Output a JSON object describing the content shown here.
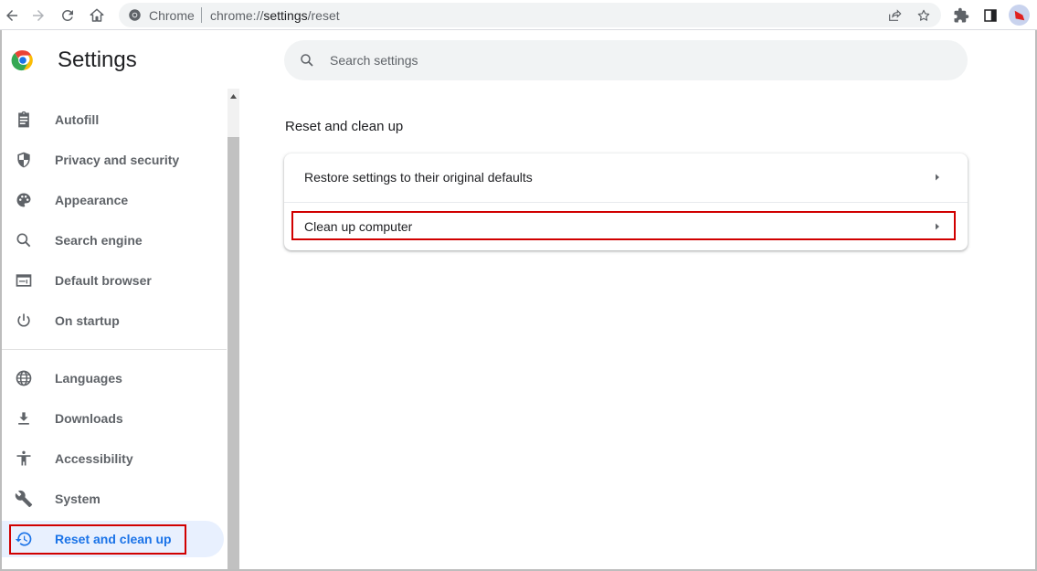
{
  "browser": {
    "site_chip": "Chrome",
    "url_prefix": "chrome://",
    "url_host": "settings",
    "url_path": "/reset",
    "icons": [
      "back-icon",
      "forward-icon",
      "reload-icon",
      "home-icon",
      "share-icon",
      "bookmark-star-icon",
      "extensions-icon",
      "side-panel-icon",
      "profile-avatar"
    ]
  },
  "header": {
    "title": "Settings",
    "search_placeholder": "Search settings"
  },
  "sidebar": {
    "items": [
      {
        "label": "Autofill",
        "icon": "clipboard-icon"
      },
      {
        "label": "Privacy and security",
        "icon": "shield-icon"
      },
      {
        "label": "Appearance",
        "icon": "palette-icon"
      },
      {
        "label": "Search engine",
        "icon": "search-icon"
      },
      {
        "label": "Default browser",
        "icon": "browser-window-icon"
      },
      {
        "label": "On startup",
        "icon": "power-icon"
      },
      {
        "label": "Languages",
        "icon": "globe-icon"
      },
      {
        "label": "Downloads",
        "icon": "download-icon"
      },
      {
        "label": "Accessibility",
        "icon": "accessibility-icon"
      },
      {
        "label": "System",
        "icon": "wrench-icon"
      },
      {
        "label": "Reset and clean up",
        "icon": "history-reset-icon",
        "active": true
      }
    ]
  },
  "main": {
    "section_title": "Reset and clean up",
    "rows": [
      {
        "label": "Restore settings to their original defaults"
      },
      {
        "label": "Clean up computer",
        "highlighted": true
      }
    ]
  },
  "colors": {
    "accent": "#1a73e8",
    "active_bg": "#e8f0fe",
    "highlight_box": "#d10000",
    "icon_gray": "#5f6368"
  }
}
